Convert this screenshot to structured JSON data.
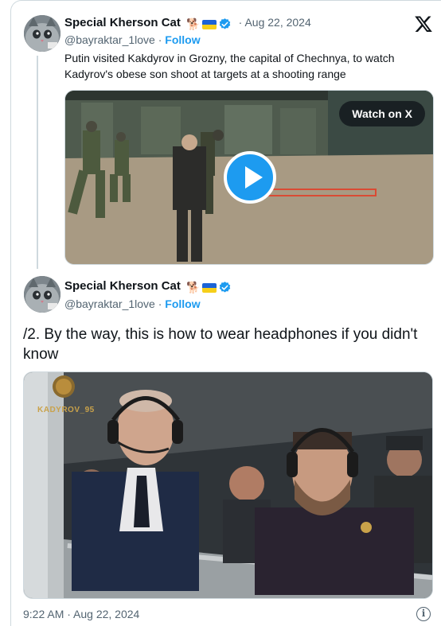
{
  "tweet1": {
    "author_name": "Special Kherson Cat",
    "author_badge_emoji": "🐕",
    "date": "· Aug 22, 2024",
    "handle": "@bayraktar_1love",
    "follow_sep": " · ",
    "follow_label": "Follow",
    "text": "Putin visited Kakdyrov in Grozny, the capital of Chechnya, to watch Kadyrov's obese son shoot at targets at a shooting range",
    "video_button": "Watch on X"
  },
  "tweet2": {
    "author_name": "Special Kherson Cat",
    "author_badge_emoji": "🐕",
    "handle": "@bayraktar_1love",
    "follow_sep": " · ",
    "follow_label": "Follow",
    "text": "/2. By the way, this is how to wear headphones if you didn't know",
    "image_watermark": "KADYROV_95"
  },
  "footer": {
    "timestamp": "9:22 AM · Aug 22, 2024",
    "info_glyph": "i"
  },
  "colors": {
    "accent": "#1d9bf0",
    "secondary_text": "#536471",
    "primary_text": "#0f1419"
  }
}
